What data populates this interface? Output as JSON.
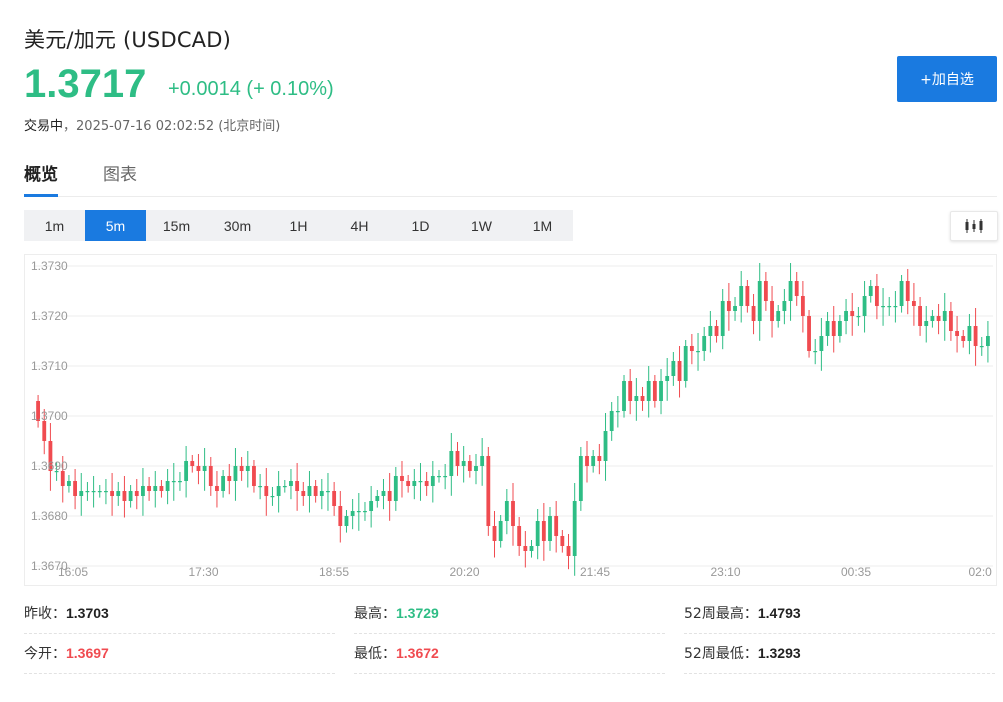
{
  "header": {
    "title": "美元/加元  (USDCAD)",
    "price": "1.3717",
    "change": "+0.0014 (+ 0.10%)",
    "status": "交易中",
    "separator": "，",
    "datetime": "2025-07-16 02:02:52  (北京时间)",
    "add_button": "+加自选"
  },
  "tabs": [
    {
      "label": "概览",
      "active": true
    },
    {
      "label": "图表",
      "active": false
    }
  ],
  "periods": [
    {
      "label": "1m"
    },
    {
      "label": "5m",
      "active": true
    },
    {
      "label": "15m"
    },
    {
      "label": "30m"
    },
    {
      "label": "1H"
    },
    {
      "label": "4H"
    },
    {
      "label": "1D"
    },
    {
      "label": "1W"
    },
    {
      "label": "1M"
    }
  ],
  "chart_type_icon": "candlestick-icon",
  "colors": {
    "up": "#2ebd85",
    "down": "#f04b50",
    "accent": "#1a7ae0"
  },
  "chart_data": {
    "type": "candlestick",
    "ylim": [
      1.367,
      1.373
    ],
    "y_ticks": [
      "1.3730",
      "1.3720",
      "1.3710",
      "1.3700",
      "1.3690",
      "1.3680",
      "1.3670"
    ],
    "x_ticks": [
      "16:05",
      "17:30",
      "18:55",
      "20:20",
      "21:45",
      "23:10",
      "00:35",
      "02:0"
    ],
    "closes": [
      1.3699,
      1.3695,
      1.3689,
      1.3689,
      1.3686,
      1.3687,
      1.3684,
      1.3685,
      1.3685,
      1.3685,
      1.3685,
      1.3685,
      1.3684,
      1.3685,
      1.3683,
      1.3685,
      1.3684,
      1.3686,
      1.3685,
      1.3686,
      1.3685,
      1.3687,
      1.3687,
      1.3687,
      1.3691,
      1.369,
      1.3689,
      1.369,
      1.3686,
      1.3685,
      1.3688,
      1.3687,
      1.369,
      1.3689,
      1.369,
      1.3686,
      1.3686,
      1.3684,
      1.3684,
      1.3686,
      1.3686,
      1.3687,
      1.3685,
      1.3684,
      1.3686,
      1.3684,
      1.3685,
      1.3685,
      1.3682,
      1.3678,
      1.368,
      1.3681,
      1.3681,
      1.3681,
      1.3683,
      1.3684,
      1.3685,
      1.3683,
      1.3688,
      1.3687,
      1.3686,
      1.3687,
      1.3687,
      1.3686,
      1.3688,
      1.3688,
      1.3688,
      1.3693,
      1.369,
      1.3691,
      1.3689,
      1.369,
      1.3692,
      1.3678,
      1.3675,
      1.3679,
      1.3683,
      1.3678,
      1.3674,
      1.3673,
      1.3674,
      1.3679,
      1.3675,
      1.368,
      1.3676,
      1.3674,
      1.3672,
      1.3683,
      1.3692,
      1.369,
      1.3692,
      1.3691,
      1.3697,
      1.3701,
      1.3701,
      1.3707,
      1.3703,
      1.3704,
      1.3703,
      1.3707,
      1.3703,
      1.3707,
      1.3708,
      1.3711,
      1.3707,
      1.3714,
      1.3713,
      1.3713,
      1.3716,
      1.3718,
      1.3716,
      1.3723,
      1.3721,
      1.3722,
      1.3726,
      1.3722,
      1.3719,
      1.3727,
      1.3723,
      1.3719,
      1.3721,
      1.3723,
      1.3727,
      1.3724,
      1.372,
      1.3713,
      1.3713,
      1.3716,
      1.3719,
      1.3716,
      1.3719,
      1.3721,
      1.372,
      1.372,
      1.3724,
      1.3726,
      1.3722,
      1.3722,
      1.3722,
      1.3722,
      1.3727,
      1.3723,
      1.3722,
      1.3718,
      1.3719,
      1.372,
      1.3719,
      1.3721,
      1.3717,
      1.3716,
      1.3715,
      1.3718,
      1.3714,
      1.3714,
      1.3716
    ]
  },
  "stats": [
    {
      "label": "昨收：",
      "value": "1.3703",
      "tone": "neutral"
    },
    {
      "label": "最高：",
      "value": "1.3729",
      "tone": "up"
    },
    {
      "label": "52周最高：",
      "value": "1.4793",
      "tone": "neutral"
    },
    {
      "label": "今开：",
      "value": "1.3697",
      "tone": "down"
    },
    {
      "label": "最低：",
      "value": "1.3672",
      "tone": "down"
    },
    {
      "label": "52周最低：",
      "value": "1.3293",
      "tone": "neutral"
    }
  ]
}
